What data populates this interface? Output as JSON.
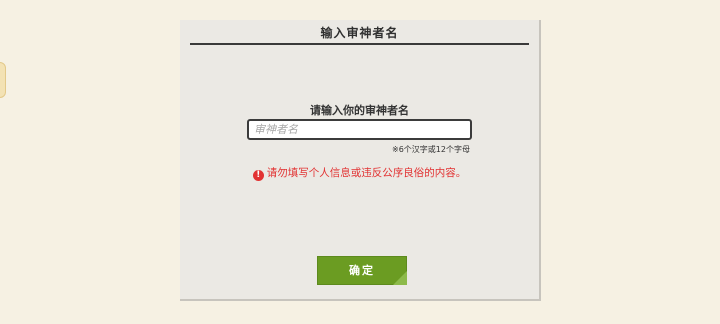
{
  "dialog": {
    "title": "输入审神者名",
    "prompt": "请输入你的审神者名",
    "input": {
      "value": "",
      "placeholder": "审神者名"
    },
    "hint": "※6个汉字或12个字母",
    "warning": {
      "icon": "!",
      "text": "请勿填写个人信息或违反公序良俗的内容。"
    },
    "confirm_label": "确定"
  },
  "colors": {
    "background": "#f6f1e3",
    "panel": "#ebe9e4",
    "warning": "#e23232",
    "confirm_button": "#6b9c22"
  }
}
